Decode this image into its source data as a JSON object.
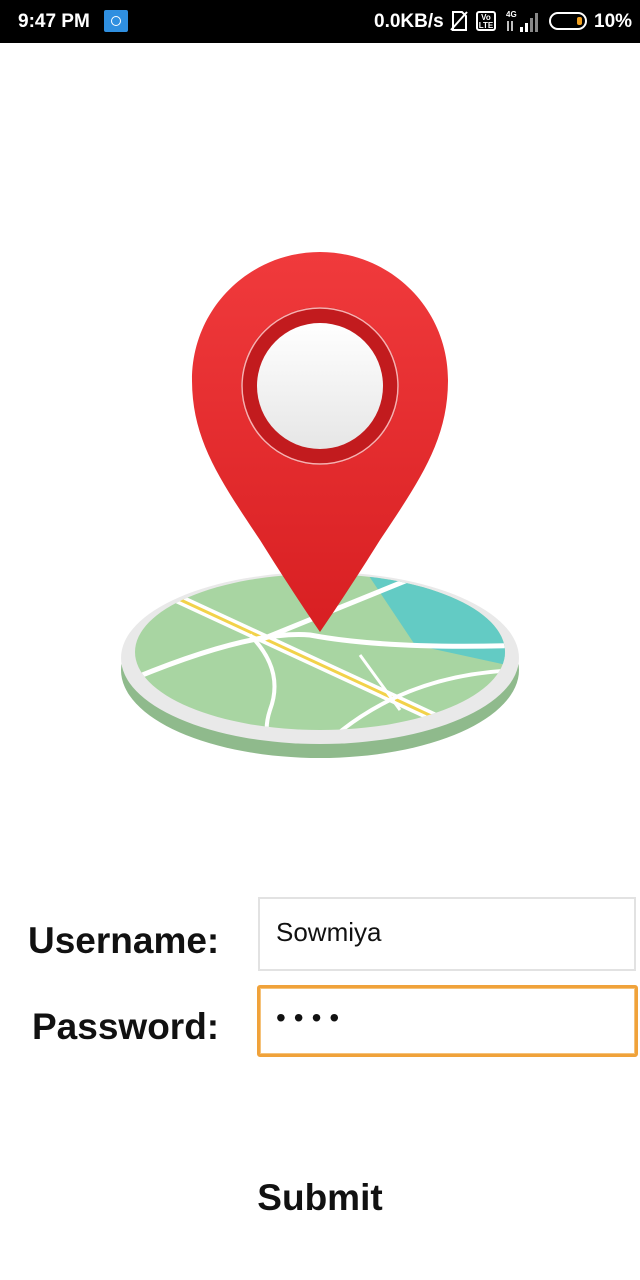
{
  "status_bar": {
    "time": "9:47 PM",
    "network_speed": "0.0KB/s",
    "volte_label": "Vo LTE",
    "network_type": "4G",
    "battery_percent": "10%",
    "icons": [
      "app-notification-icon",
      "no-sim-icon",
      "volte-icon",
      "signal-icon",
      "battery-icon"
    ]
  },
  "illustration": {
    "description_icon": "location-pin-on-map-icon",
    "colors": {
      "pin_red": "#e8272a",
      "map_green": "#a8d5a2",
      "map_teal": "#63cbc4",
      "road_yellow": "#f2d24a"
    }
  },
  "form": {
    "username_label": "Username:",
    "username_value": "Sowmiya",
    "password_label": "Password:",
    "password_value": "••••",
    "submit_label": "Submit"
  },
  "colors": {
    "focus_border": "#f0a23a",
    "field_border": "#e2e2e2",
    "status_bar_bg": "#000000"
  }
}
